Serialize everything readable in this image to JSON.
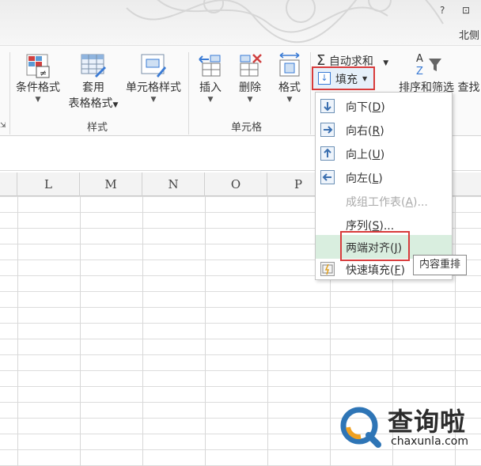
{
  "titlebar": {
    "help_label": "?",
    "restore_label": "⊡",
    "user_label": "北侧"
  },
  "ribbon": {
    "conditional_format": "条件格式",
    "table_format_line1": "套用",
    "table_format_line2": "表格格式",
    "cell_styles": "单元格样式",
    "styles_group": "样式",
    "insert": "插入",
    "delete": "删除",
    "format": "格式",
    "cells_group": "单元格",
    "autosum": "自动求和",
    "sigma": "Σ",
    "fill": "填充",
    "sort_filter": "排序和筛选",
    "find": "查找"
  },
  "columns": [
    "L",
    "M",
    "N",
    "O",
    "P"
  ],
  "fill_menu": {
    "down": {
      "label": "向下",
      "key": "D"
    },
    "right": {
      "label": "向右",
      "key": "R"
    },
    "up": {
      "label": "向上",
      "key": "U"
    },
    "left": {
      "label": "向左",
      "key": "L"
    },
    "across_sheets": {
      "label": "成组工作表",
      "key": "A",
      "suffix": "..."
    },
    "series": {
      "label": "序列",
      "key": "S",
      "suffix": "..."
    },
    "justify": {
      "label": "两端对齐",
      "key": "J"
    },
    "flash_fill": {
      "label": "快速填充",
      "key": "F"
    }
  },
  "tooltip": "内容重排",
  "watermark": {
    "title": "查询啦",
    "url": "chaxunla.com"
  },
  "colors": {
    "highlight_red": "#d83b3b",
    "hover_green": "#d9eedf",
    "accent_blue": "#2e75b6"
  }
}
